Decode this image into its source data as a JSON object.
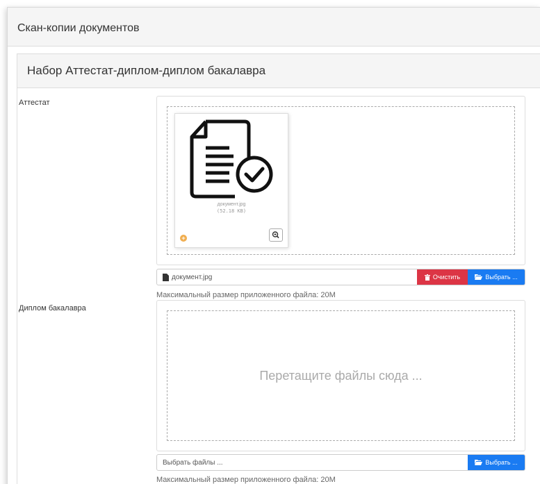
{
  "panel": {
    "title": "Скан-копии документов"
  },
  "set": {
    "title": "Набор Аттестат-диплом-диплом бакалавра"
  },
  "attestat": {
    "label": "Аттестат",
    "file": {
      "name": "документ.jpg",
      "size": "(52.18 KB)"
    },
    "caption": "документ.jpg",
    "clear_label": "Очистить",
    "browse_label": "Выбрать ...",
    "hint": "Максимальный размер приложенного файла: 20M"
  },
  "diploma": {
    "label": "Диплом бакалавра",
    "drop_text": "Перетащите файлы сюда ...",
    "caption": "Выбрать файлы ...",
    "browse_label": "Выбрать ...",
    "hint": "Максимальный размер приложенного файла: 20M"
  },
  "icons": {
    "document": "document-check-icon",
    "status": "plus-circle-icon",
    "zoom": "zoom-in-icon",
    "file": "file-icon",
    "trash": "trash-icon",
    "folder": "folder-open-icon"
  },
  "colors": {
    "danger": "#dc3545",
    "primary": "#1a7bf2",
    "warning": "#f0ad4e"
  }
}
